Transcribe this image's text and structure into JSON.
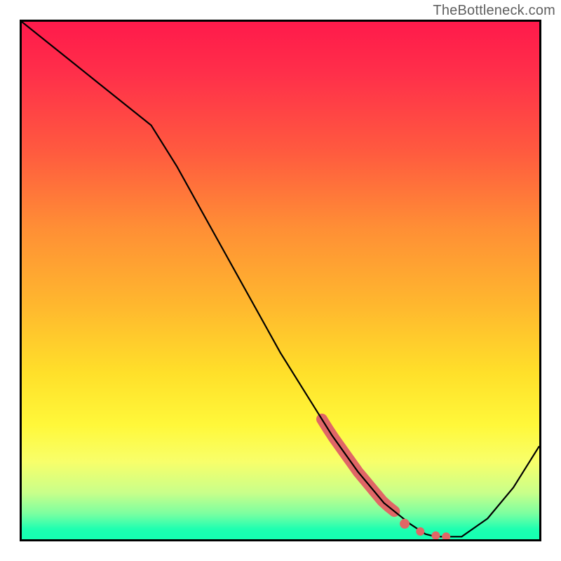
{
  "watermark": "TheBottleneck.com",
  "chart_data": {
    "type": "line",
    "title": "",
    "xlabel": "",
    "ylabel": "",
    "xlim": [
      0,
      100
    ],
    "ylim": [
      0,
      100
    ],
    "grid": false,
    "legend": false,
    "series": [
      {
        "name": "bottleneck-curve",
        "x": [
          0,
          5,
          10,
          15,
          20,
          25,
          30,
          35,
          40,
          45,
          50,
          55,
          60,
          65,
          70,
          75,
          78,
          80,
          82,
          85,
          90,
          95,
          100
        ],
        "y": [
          100,
          96,
          92,
          88,
          84,
          80,
          72,
          63,
          54,
          45,
          36,
          28,
          20,
          13,
          7,
          3,
          1,
          0.5,
          0.5,
          0.5,
          4,
          10,
          18
        ],
        "color": "#000000"
      }
    ],
    "markers": [
      {
        "name": "highlight-thick-segment",
        "shape": "segment",
        "color": "#e06666",
        "x_range": [
          58,
          72
        ],
        "y_range_approx": [
          22,
          6
        ]
      },
      {
        "name": "highlight-dots",
        "shape": "dots",
        "color": "#e06666",
        "points_x": [
          74,
          77,
          80,
          82
        ],
        "points_y_approx": [
          3,
          1.5,
          0.7,
          0.5
        ]
      }
    ],
    "background_gradient": {
      "top": "#ff1a4b",
      "mid": "#ffe02a",
      "bottom": "#16ffb1"
    }
  }
}
